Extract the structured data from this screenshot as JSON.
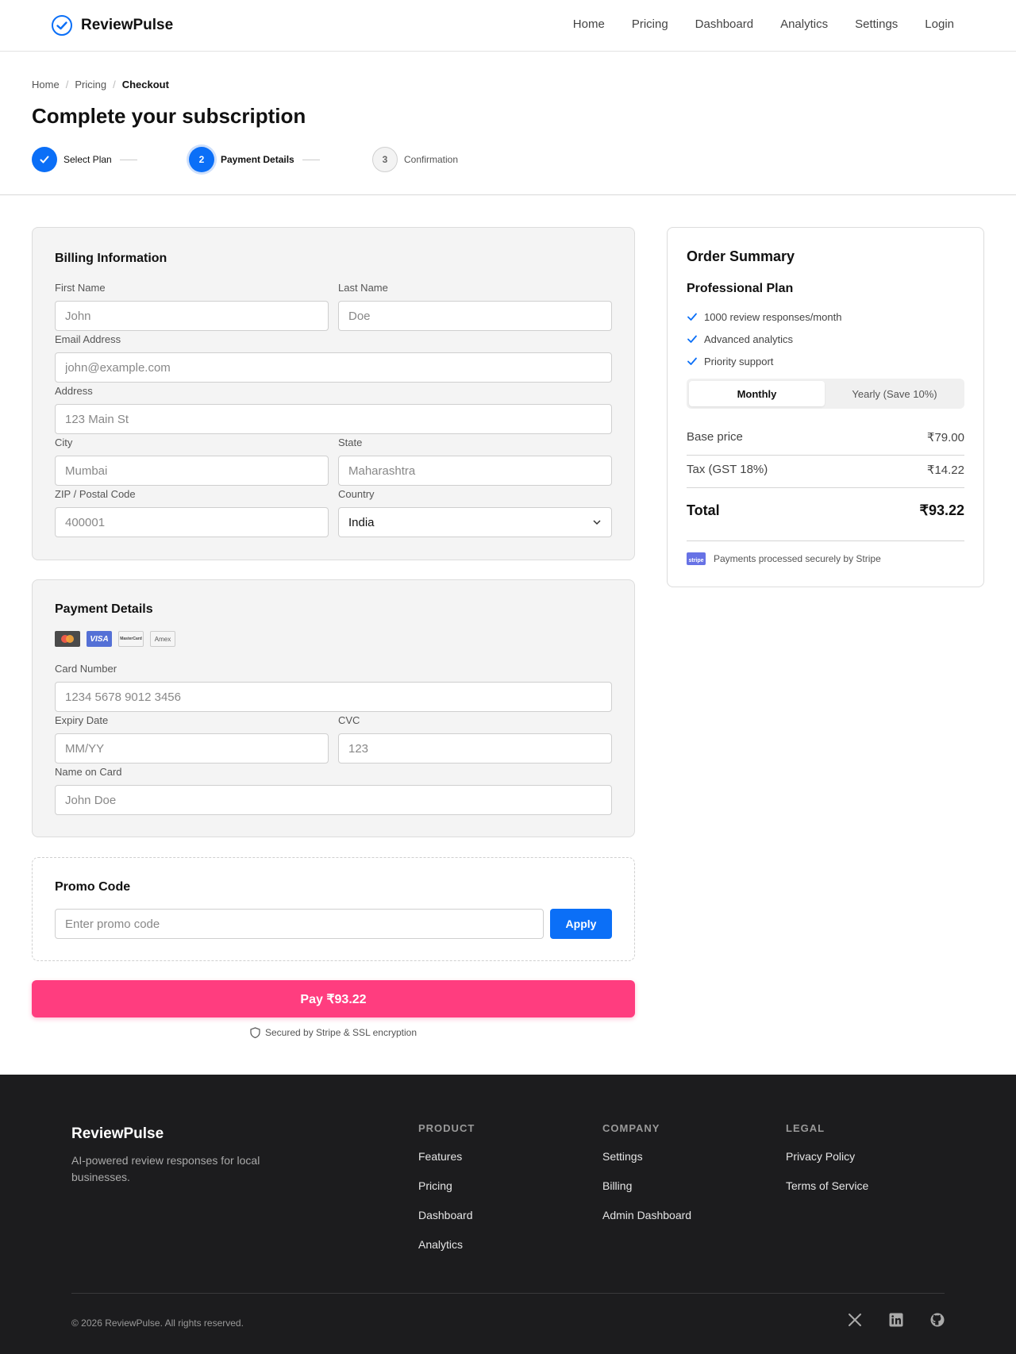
{
  "header": {
    "brand": "ReviewPulse",
    "nav": [
      "Home",
      "Pricing",
      "Dashboard",
      "Analytics",
      "Settings",
      "Login"
    ]
  },
  "breadcrumb": [
    "Home",
    "Pricing",
    "Checkout"
  ],
  "page_title": "Complete your subscription",
  "stepper": {
    "steps": [
      {
        "label": "Select Plan",
        "state": "done",
        "number": ""
      },
      {
        "label": "Payment Details",
        "state": "active",
        "number": "2"
      },
      {
        "label": "Confirmation",
        "state": "todo",
        "number": "3"
      }
    ]
  },
  "billing": {
    "title": "Billing Information",
    "first_name": {
      "label": "First Name",
      "placeholder": "John"
    },
    "last_name": {
      "label": "Last Name",
      "placeholder": "Doe"
    },
    "email": {
      "label": "Email Address",
      "placeholder": "john@example.com"
    },
    "address": {
      "label": "Address",
      "placeholder": "123 Main St"
    },
    "city": {
      "label": "City",
      "placeholder": "Mumbai"
    },
    "state": {
      "label": "State",
      "placeholder": "Maharashtra"
    },
    "zip": {
      "label": "ZIP / Postal Code",
      "placeholder": "400001"
    },
    "country": {
      "label": "Country",
      "value": "India"
    }
  },
  "payment": {
    "title": "Payment Details",
    "card_brands": [
      "mastercard-icon",
      "visa-icon",
      "mastercard-text-icon",
      "amex-icon"
    ],
    "card_brand_text": {
      "visa": "VISA",
      "mastercard": "MasterCard",
      "amex": "Amex"
    },
    "card_number": {
      "label": "Card Number",
      "placeholder": "1234 5678 9012 3456"
    },
    "expiry": {
      "label": "Expiry Date",
      "placeholder": "MM/YY"
    },
    "cvc": {
      "label": "CVC",
      "placeholder": "123"
    },
    "name_on_card": {
      "label": "Name on Card",
      "placeholder": "John Doe"
    }
  },
  "promo": {
    "title": "Promo Code",
    "placeholder": "Enter promo code",
    "apply_label": "Apply"
  },
  "pay_button": "Pay ₹93.22",
  "secure_note": "Secured by Stripe & SSL encryption",
  "summary": {
    "title": "Order Summary",
    "plan": "Professional Plan",
    "features": [
      "1000 review responses/month",
      "Advanced analytics",
      "Priority support"
    ],
    "billing_toggle": {
      "monthly": "Monthly",
      "yearly": "Yearly (Save 10%)",
      "selected": "Monthly"
    },
    "base_price_label": "Base price",
    "base_price": "₹79.00",
    "tax_label": "Tax (GST 18%)",
    "tax": "₹14.22",
    "total_label": "Total",
    "total": "₹93.22",
    "stripe_badge": "stripe",
    "stripe_note": "Payments processed securely by Stripe"
  },
  "footer": {
    "brand": "ReviewPulse",
    "tagline": "AI-powered review responses for local businesses.",
    "columns": [
      {
        "title": "PRODUCT",
        "links": [
          "Features",
          "Pricing",
          "Dashboard",
          "Analytics"
        ]
      },
      {
        "title": "COMPANY",
        "links": [
          "Settings",
          "Billing",
          "Admin Dashboard"
        ]
      },
      {
        "title": "LEGAL",
        "links": [
          "Privacy Policy",
          "Terms of Service"
        ]
      }
    ],
    "copyright": "© 2026 ReviewPulse. All rights reserved.",
    "social": [
      "x-icon",
      "linkedin-icon",
      "github-icon"
    ]
  },
  "colors": {
    "accent": "#0b6ff7",
    "pay_button": "#ff3d7f",
    "footer_bg": "#1c1c1e"
  }
}
